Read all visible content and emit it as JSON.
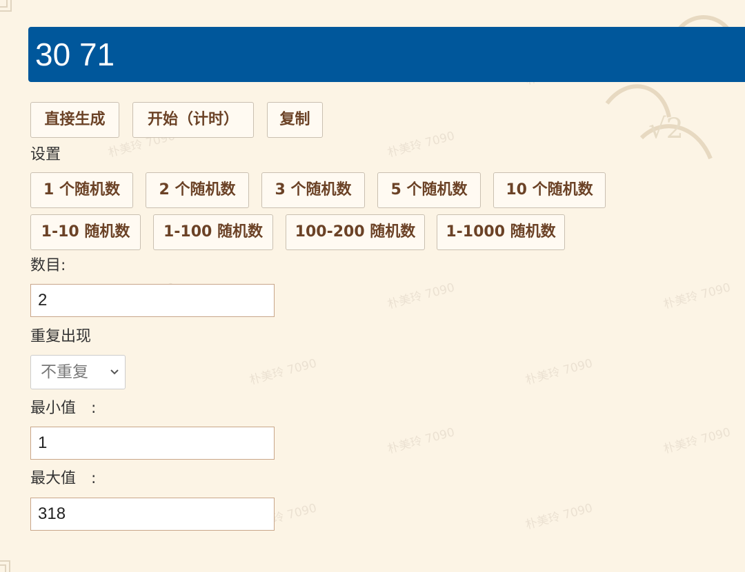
{
  "result": {
    "text": "30 71"
  },
  "actions": {
    "generate": "直接生成",
    "start_timed": "开始（计时）",
    "copy": "复制"
  },
  "settings": {
    "heading": "设置",
    "presets_row1": [
      "1 个随机数",
      "2 个随机数",
      "3 个随机数",
      "5 个随机数",
      "10 个随机数"
    ],
    "presets_row2": [
      "1-10 随机数",
      "1-100 随机数",
      "100-200 随机数",
      "1-1000 随机数"
    ]
  },
  "form": {
    "count_label": "数目:",
    "count_value": "2",
    "repeat_label": "重复出现",
    "repeat_value": "不重复",
    "min_label": "最小值　:",
    "min_value": "1",
    "max_label": "最大值　:",
    "max_value": "318"
  },
  "watermark": {
    "text": "朴美玲 7090"
  },
  "icons": {
    "dropdown": "chevron-down-icon"
  },
  "colors": {
    "background": "#fcf4e5",
    "result_bar": "#00579b",
    "button_text": "#6b4226",
    "button_border": "#c9bfb0",
    "field_border": "#c8a589"
  }
}
